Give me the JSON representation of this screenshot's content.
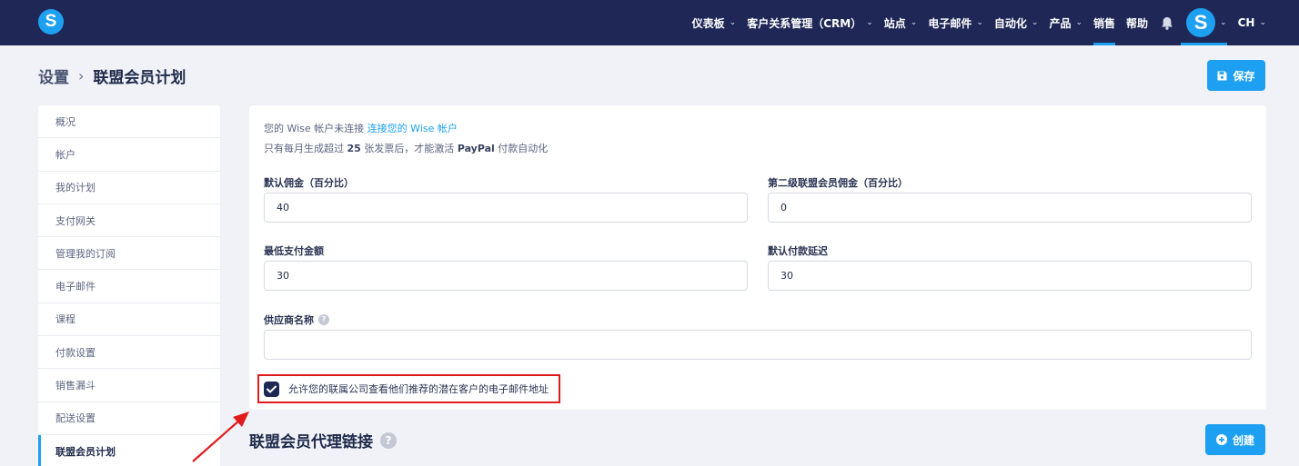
{
  "nav": {
    "logo": "S",
    "items": [
      {
        "label": "仪表板",
        "chevron": true
      },
      {
        "label": "客户关系管理（CRM）",
        "chevron": true
      },
      {
        "label": "站点",
        "chevron": true
      },
      {
        "label": "电子邮件",
        "chevron": true
      },
      {
        "label": "自动化",
        "chevron": true
      },
      {
        "label": "产品",
        "chevron": true
      },
      {
        "label": "销售",
        "chevron": false,
        "active": true
      },
      {
        "label": "帮助",
        "chevron": false
      }
    ],
    "avatar": "S",
    "language": "CH"
  },
  "breadcrumb": {
    "root": "设置",
    "current": "联盟会员计划"
  },
  "toolbar": {
    "save_label": "保存"
  },
  "sidebar": {
    "items": [
      {
        "label": "概况"
      },
      {
        "label": "帐户"
      },
      {
        "label": "我的计划"
      },
      {
        "label": "支付网关"
      },
      {
        "label": "管理我的订阅"
      },
      {
        "label": "电子邮件"
      },
      {
        "label": "课程"
      },
      {
        "label": "付款设置"
      },
      {
        "label": "销售漏斗"
      },
      {
        "label": "配送设置"
      },
      {
        "label": "联盟会员计划",
        "active": true
      }
    ]
  },
  "info": {
    "wise_text": "您的 Wise 帐户未连接",
    "wise_link": "连接您的 Wise 帐户",
    "paypal_pre": "只有每月生成超过",
    "paypal_count": "25",
    "paypal_post": "张发票后，才能激活",
    "paypal_brand": "PayPal",
    "paypal_tail": "付款自动化"
  },
  "form": {
    "default_commission": {
      "label": "默认佣金（百分比）",
      "value": "40"
    },
    "second_level_commission": {
      "label": "第二级联盟会员佣金（百分比）",
      "value": "0"
    },
    "min_payout": {
      "label": "最低支付金额",
      "value": "30"
    },
    "payout_delay": {
      "label": "默认付款延迟",
      "value": "30"
    },
    "vendor_name": {
      "label": "供应商名称",
      "value": "",
      "help": "?"
    },
    "allow_email_view": {
      "label": "允许您的联属公司查看他们推荐的潜在客户的电子邮件地址",
      "checked": true
    }
  },
  "links_section": {
    "title": "联盟会员代理链接",
    "help": "?",
    "create_label": "创建"
  },
  "colors": {
    "nav_bg": "#1e2756",
    "accent": "#1ea0f2",
    "highlight": "#e01b1b"
  }
}
